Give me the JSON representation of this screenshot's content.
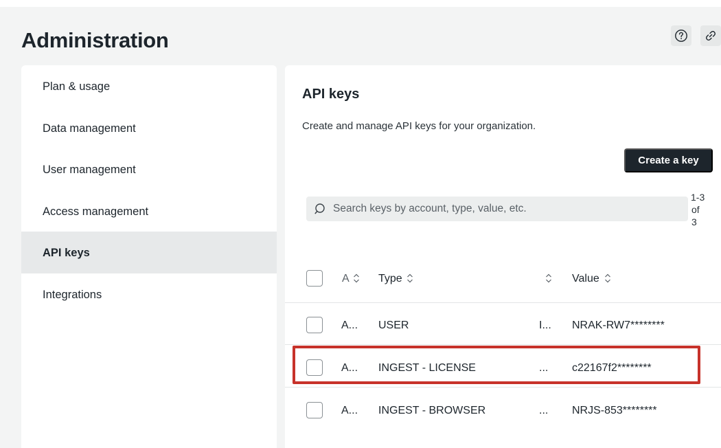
{
  "header": {
    "title": "Administration",
    "help_icon": "question-circle-icon",
    "link_icon": "link-icon"
  },
  "sidebar": {
    "items": [
      {
        "label": "Plan & usage",
        "active": false
      },
      {
        "label": "Data management",
        "active": false
      },
      {
        "label": "User management",
        "active": false
      },
      {
        "label": "Access management",
        "active": false
      },
      {
        "label": "API keys",
        "active": true
      },
      {
        "label": "Integrations",
        "active": false
      }
    ]
  },
  "main": {
    "title": "API keys",
    "description": "Create and manage API keys for your organization.",
    "create_button": "Create a key",
    "search": {
      "placeholder": "Search keys by account, type, value, etc.",
      "value": ""
    },
    "pagination": {
      "line1": "1-3",
      "line2": "of",
      "line3": "3"
    },
    "table": {
      "columns": [
        {
          "label": "A",
          "truncated": true
        },
        {
          "label": "Type"
        },
        {
          "label": ""
        },
        {
          "label": "Value"
        }
      ],
      "rows": [
        {
          "account": "A...",
          "type": "USER",
          "col3": "I...",
          "value": "NRAK-RW7********",
          "highlighted": false
        },
        {
          "account": "A...",
          "type": "INGEST - LICENSE",
          "col3": "...",
          "value": "c22167f2********",
          "highlighted": true
        },
        {
          "account": "A...",
          "type": "INGEST - BROWSER",
          "col3": "...",
          "value": "NRJS-853********",
          "highlighted": false
        }
      ]
    }
  },
  "colors": {
    "accent_dark": "#1d252c",
    "highlight_border": "#c7322a",
    "active_nav": "#e7e9ea",
    "background": "#f3f4f4"
  }
}
